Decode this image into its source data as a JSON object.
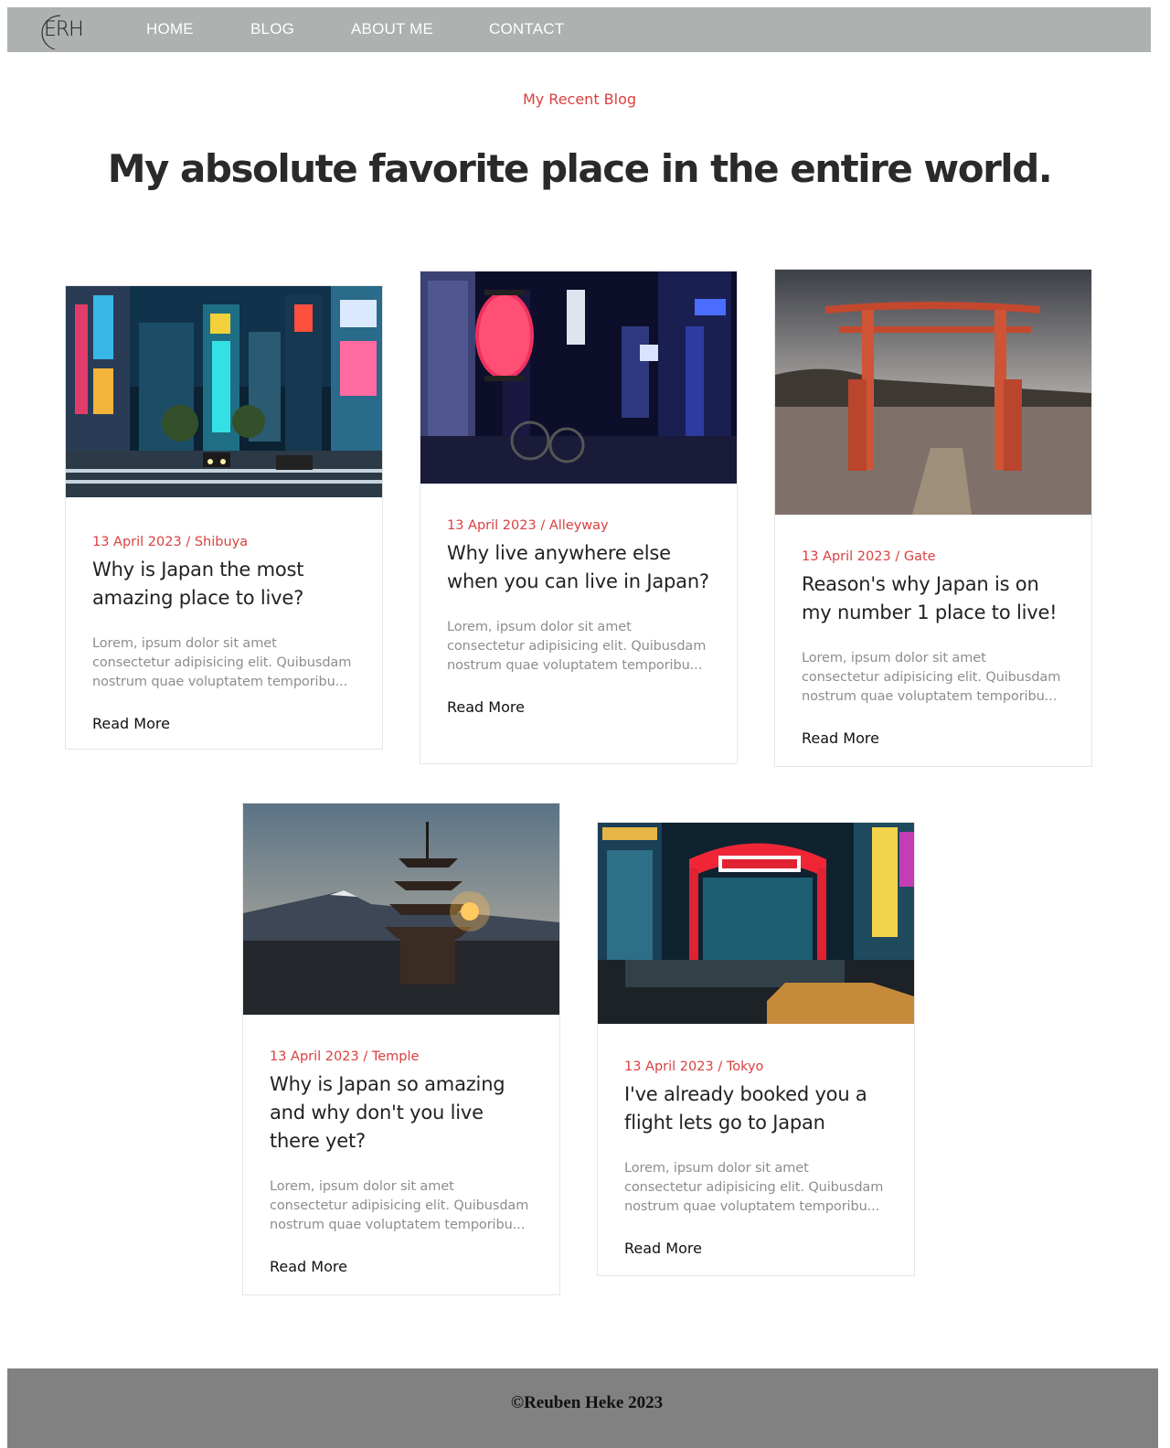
{
  "nav": {
    "logo_text": "ERH",
    "links": [
      "HOME",
      "BLOG",
      "ABOUT ME",
      "CONTACT"
    ]
  },
  "hero": {
    "subtitle": "My Recent Blog",
    "title": "My absolute favorite place in the entire world."
  },
  "posts": [
    {
      "date": "13 April 2023",
      "category": "Shibuya",
      "title": "Why is Japan the most amazing place to live?",
      "excerpt": "Lorem, ipsum dolor sit amet consectetur adipisicing elit. Quibusdam nostrum quae voluptatem temporibu...",
      "link": "Read More",
      "image": "Shibuya crossing at night with neon billboards"
    },
    {
      "date": "13 April 2023",
      "category": "Alleyway",
      "title": "Why live anywhere else when you can live in Japan?",
      "excerpt": "Lorem, ipsum dolor sit amet consectetur adipisicing elit. Quibusdam nostrum quae voluptatem temporibu...",
      "link": "Read More",
      "image": "Neon alleyway with red paper lantern"
    },
    {
      "date": "13 April 2023",
      "category": "Gate",
      "title": "Reason's why Japan is on my number 1 place to live!",
      "excerpt": "Lorem, ipsum dolor sit amet consectetur adipisicing elit. Quibusdam nostrum quae voluptatem temporibu...",
      "link": "Read More",
      "image": "Red torii gate standing in a lake"
    },
    {
      "date": "13 April 2023",
      "category": "Temple",
      "title": "Why is Japan so amazing and why don't you live there yet?",
      "excerpt": "Lorem, ipsum dolor sit amet consectetur adipisicing elit. Quibusdam nostrum quae voluptatem temporibu...",
      "link": "Read More",
      "image": "Pagoda at sunset with Mount Fuji"
    },
    {
      "date": "13 April 2023",
      "category": "Tokyo",
      "title": "I've already booked you a flight lets go to Japan",
      "excerpt": "Lorem, ipsum dolor sit amet consectetur adipisicing elit. Quibusdam nostrum quae voluptatem temporibu...",
      "link": "Read More",
      "image": "Kabukicho gate with crowd at night"
    }
  ],
  "footer": {
    "text": "©Reuben Heke 2023"
  }
}
